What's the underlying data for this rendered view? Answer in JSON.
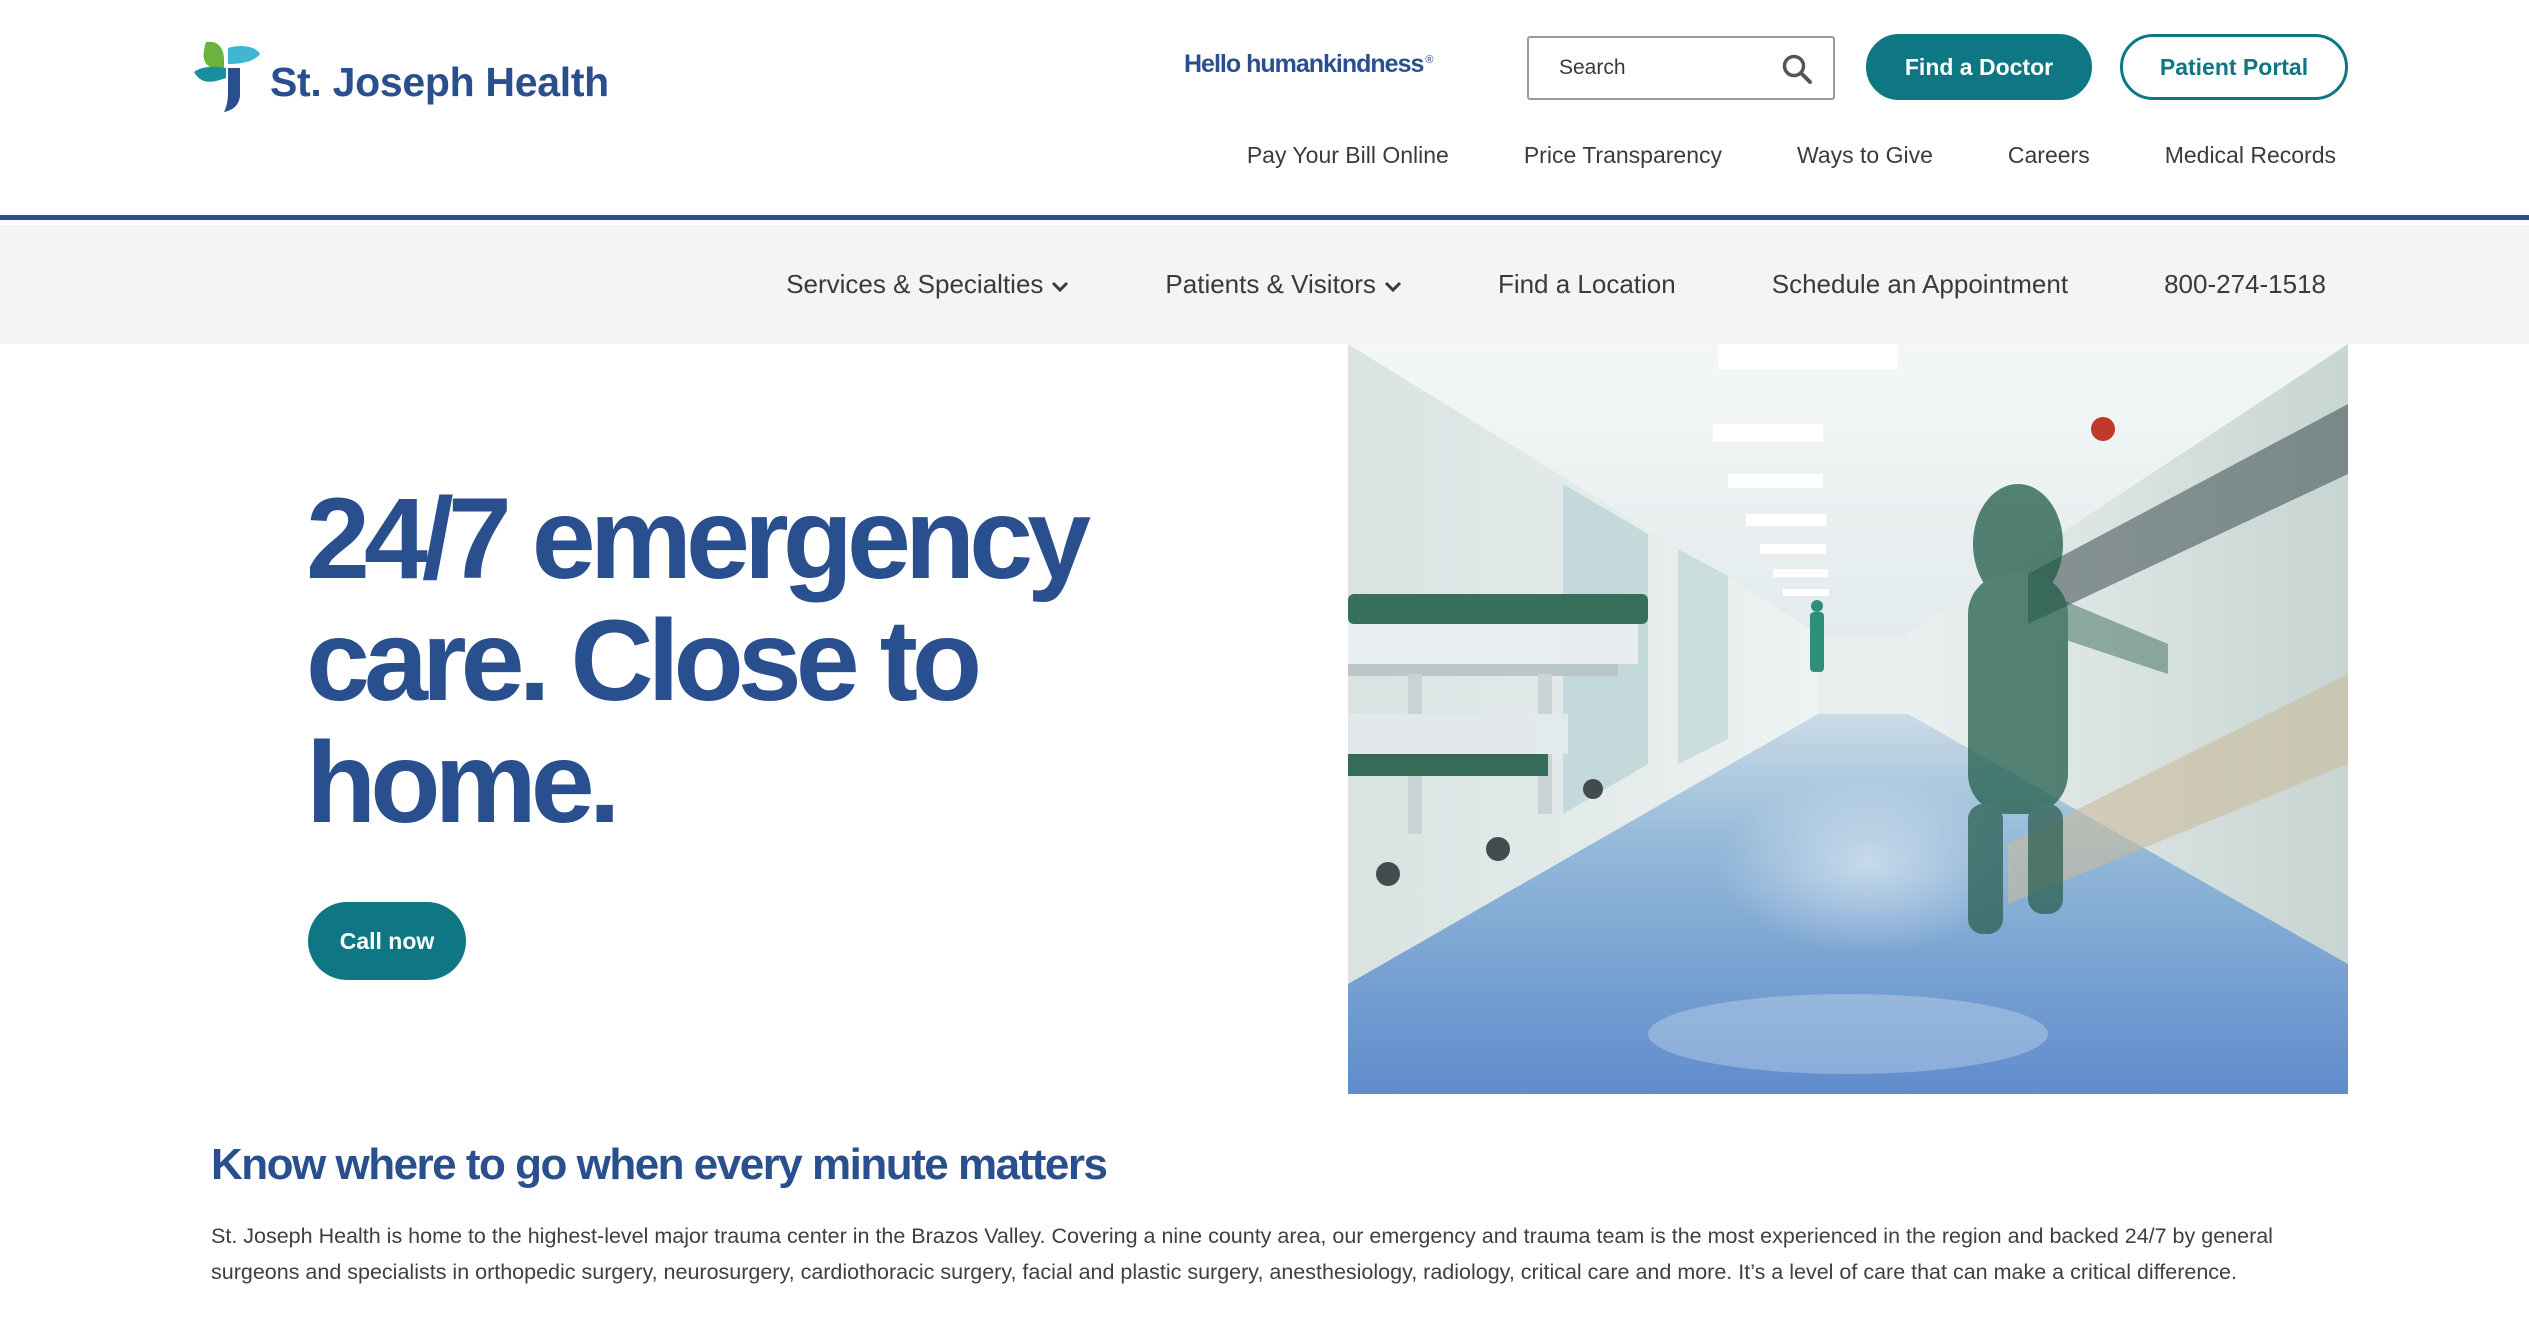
{
  "header": {
    "logo_text": "St. Joseph Health",
    "tagline": "Hello humankindness",
    "tagline_mark": "®",
    "search": {
      "placeholder": "Search",
      "value": ""
    },
    "find_doctor_label": "Find a Doctor",
    "patient_portal_label": "Patient Portal",
    "utility_links": [
      {
        "label": "Pay Your Bill Online"
      },
      {
        "label": "Price Transparency"
      },
      {
        "label": "Ways to Give"
      },
      {
        "label": "Careers"
      },
      {
        "label": "Medical Records"
      }
    ]
  },
  "main_nav": {
    "items": [
      {
        "label": "Services & Specialties",
        "has_dropdown": true
      },
      {
        "label": "Patients & Visitors",
        "has_dropdown": true
      },
      {
        "label": "Find a Location",
        "has_dropdown": false
      },
      {
        "label": "Schedule an Appointment",
        "has_dropdown": false
      },
      {
        "label": "800-274-1518",
        "has_dropdown": false
      }
    ]
  },
  "hero": {
    "title": "24/7 emergency care. Close to home.",
    "cta_label": "Call now",
    "image_alt": "hospital-corridor-photo"
  },
  "intro": {
    "title": "Know where to go when every minute matters",
    "body": "St. Joseph Health is home to the highest-level major trauma center in the Brazos Valley. Covering a nine county area, our emergency and trauma team is the most experienced in the region and backed 24/7 by general surgeons and specialists in orthopedic surgery, neurosurgery, cardiothoracic surgery, facial and plastic surgery, anesthesiology, radiology, critical care and more. It’s a level of care that can make a critical difference."
  },
  "colors": {
    "brand_blue": "#2a4f8f",
    "teal": "#0e7783",
    "nav_bg": "#f4f4f4",
    "text_gray": "#3b3b3b"
  },
  "icons": {
    "logo": "cross-logo-icon",
    "search": "search-icon",
    "dropdown": "chevron-down-icon"
  }
}
